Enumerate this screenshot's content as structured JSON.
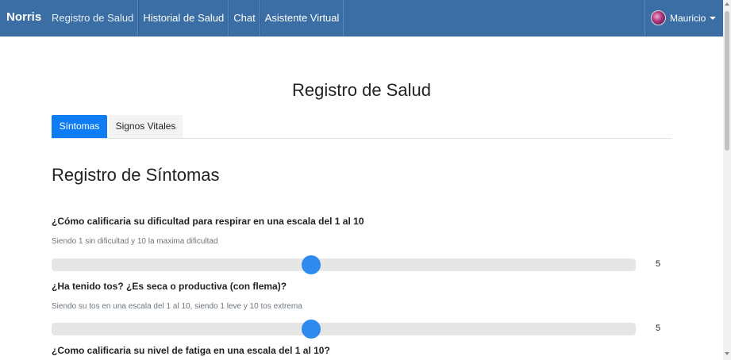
{
  "navbar": {
    "brand": "Norris",
    "links": [
      "Registro de Salud",
      "Historial de Salud",
      "Chat",
      "Asistente Virtual"
    ],
    "user": "Mauricio"
  },
  "page_title": "Registro de Salud",
  "tabs": [
    "Síntomas",
    "Signos Vitales"
  ],
  "active_tab": "Síntomas",
  "section_title": "Registro de Síntomas",
  "questions": [
    {
      "question": "¿Cómo calificaria su dificultad para respirar en una escala del 1 al 10",
      "hint": "Siendo 1 sin dificultad y 10 la maxima dificultad",
      "value": "5",
      "min": 1,
      "max": 10
    },
    {
      "question": "¿Ha tenido tos? ¿Es seca o productiva (con flema)?",
      "hint": "Siendo su tos en una escala del 1 al 10, siendo 1 leve y 10 tos extrema",
      "value": "5",
      "min": 1,
      "max": 10
    },
    {
      "question": "¿Como calificaria su nivel de fatiga en una escala del 1 al 10?"
    }
  ],
  "colors": {
    "navbar": "#3a6ea5",
    "accent": "#0d7cf5",
    "slider_thumb": "#2f8af0"
  }
}
